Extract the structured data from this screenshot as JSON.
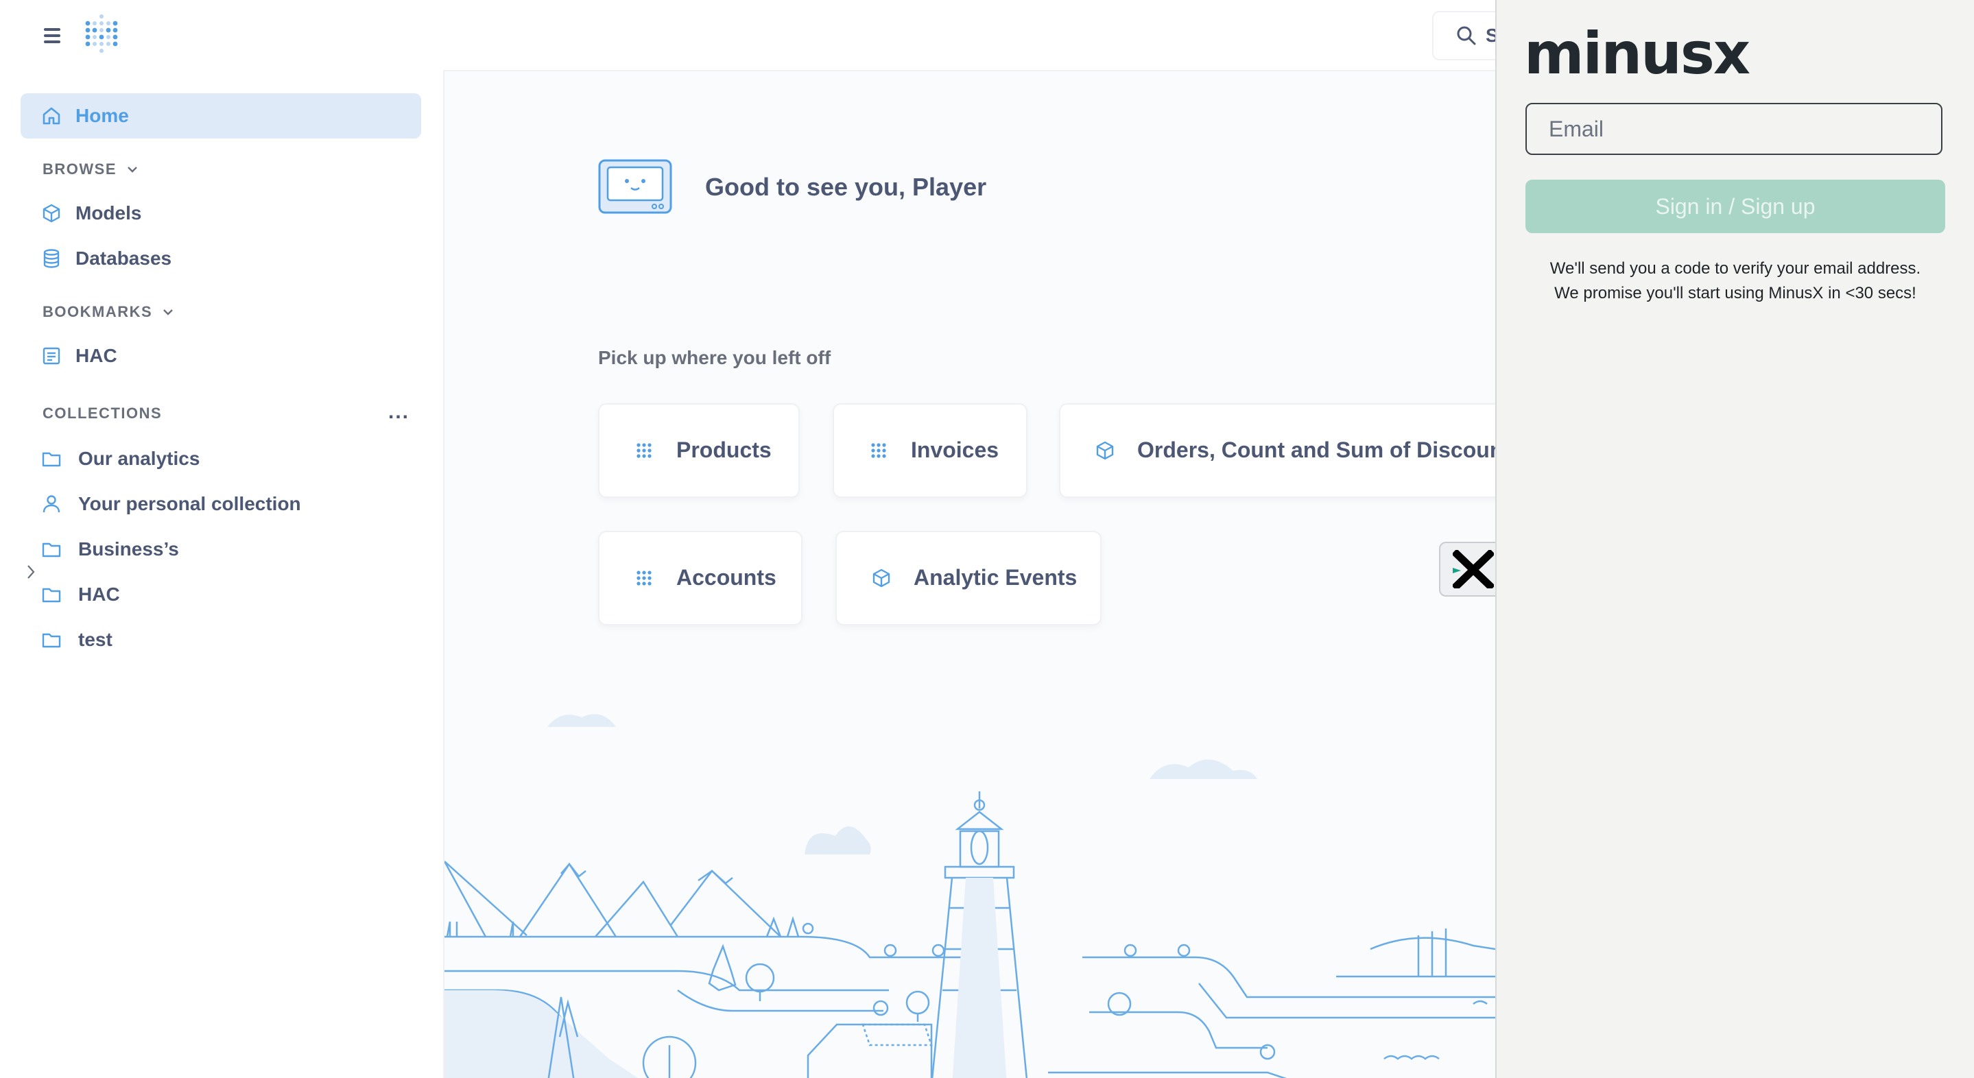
{
  "topbar": {
    "search_partial": "S"
  },
  "sidebar": {
    "home_label": "Home",
    "browse": {
      "heading": "BROWSE",
      "items": [
        {
          "label": "Models"
        },
        {
          "label": "Databases"
        }
      ]
    },
    "bookmarks": {
      "heading": "BOOKMARKS",
      "items": [
        {
          "label": "HAC"
        }
      ]
    },
    "collections": {
      "heading": "COLLECTIONS",
      "more": "...",
      "items": [
        {
          "label": "Our analytics"
        },
        {
          "label": "Your personal collection"
        },
        {
          "label": "Business’s"
        },
        {
          "label": "HAC"
        },
        {
          "label": "test"
        }
      ]
    }
  },
  "main": {
    "greeting": "Good to see you, Player",
    "pickup_heading": "Pick up where you left off",
    "cards": [
      {
        "title": "Products",
        "icon": "grid-icon"
      },
      {
        "title": "Invoices",
        "icon": "grid-icon"
      },
      {
        "title": "Orders, Count and Sum of Discount, C",
        "icon": "model-cube-icon"
      },
      {
        "title": "Accounts",
        "icon": "grid-icon"
      },
      {
        "title": "Analytic Events",
        "icon": "model-cube-icon"
      }
    ]
  },
  "minusx": {
    "brand": "minusx",
    "email_placeholder": "Email",
    "signin_label": "Sign in / Sign up",
    "note_line1": "We'll send you a code to verify your email address.",
    "note_line2": "We promise you'll start using MinusX in <30 secs!",
    "accent": "#16a085"
  },
  "colors": {
    "brand_blue": "#509ee3",
    "text": "#4c5773",
    "active_bg": "#deeaf7"
  }
}
